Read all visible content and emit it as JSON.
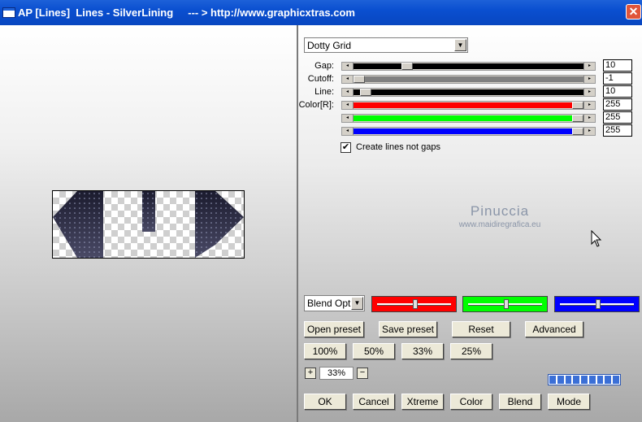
{
  "window": {
    "title": "AP [Lines]  Lines - SilverLining     --- > http://www.graphicxtras.com",
    "close": "✕"
  },
  "pattern_dropdown": "Dotty Grid",
  "sliders": [
    {
      "label": "Gap:",
      "value": "10",
      "position": 0.22,
      "fill": "#000000"
    },
    {
      "label": "Cutoff:",
      "value": "-1",
      "position": 0.0,
      "fill": "#808080"
    },
    {
      "label": "Line:",
      "value": "10",
      "position": 0.03,
      "fill": "#000000"
    },
    {
      "label": "Color[R]:",
      "value": "255",
      "position": 1.0,
      "fill": "#ff0000"
    },
    {
      "label": "",
      "value": "255",
      "position": 1.0,
      "fill": "#00ff00"
    },
    {
      "label": "",
      "value": "255",
      "position": 1.0,
      "fill": "#0000ff"
    }
  ],
  "checkbox": {
    "label": "Create lines not gaps",
    "checked": true,
    "mark": "✔"
  },
  "watermark": {
    "name": "Pinuccia",
    "site": "www.maidiregrafica.eu"
  },
  "blend_dropdown": "Blend Optio",
  "color_mini_sliders": [
    {
      "color": "#ff0000",
      "position": 0.5
    },
    {
      "color": "#00ff00",
      "position": 0.5
    },
    {
      "color": "#0000ff",
      "position": 0.5
    }
  ],
  "preset_buttons": {
    "open": "Open preset",
    "save": "Save preset",
    "reset": "Reset",
    "advanced": "Advanced"
  },
  "zoom_buttons": [
    "100%",
    "50%",
    "33%",
    "25%"
  ],
  "zoom": {
    "plus": "+",
    "value": "33%",
    "minus": "−"
  },
  "bottom_buttons": [
    "OK",
    "Cancel",
    "Xtreme",
    "Color",
    "Blend",
    "Mode"
  ]
}
